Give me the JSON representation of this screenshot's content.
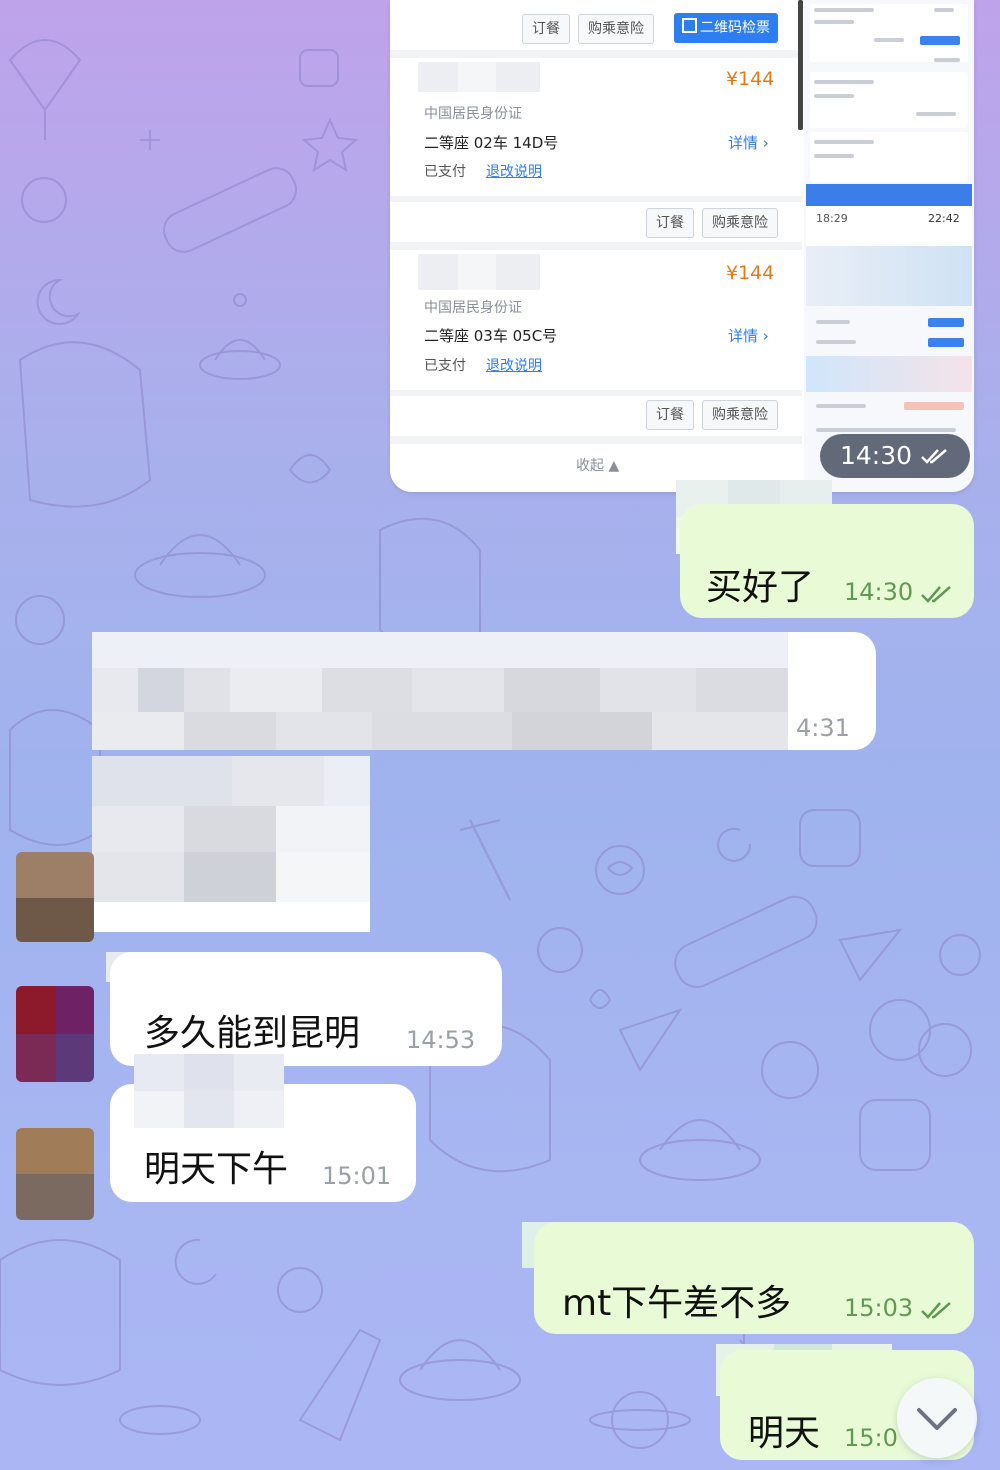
{
  "screenshot": {
    "top_buttons": {
      "meal": "订餐",
      "insurance": "购乘意险",
      "qr": "二维码检票"
    },
    "tickets": [
      {
        "price": "¥144",
        "id_type": "中国居民身份证",
        "seat": "二等座 02车 14D号",
        "status": "已支付",
        "refund_link": "退改说明",
        "detail": "详情 ›",
        "meal": "订餐",
        "insurance": "购乘意险"
      },
      {
        "price": "¥144",
        "id_type": "中国居民身份证",
        "seat": "二等座 03车 05C号",
        "status": "已支付",
        "refund_link": "退改说明",
        "detail": "详情 ›",
        "meal": "订餐",
        "insurance": "购乘意险"
      }
    ],
    "collapse_label": "收起 ▲",
    "app_preview": {
      "depart_time": "18:29",
      "arrive_time": "22:42"
    },
    "timestamp": "14:30"
  },
  "messages": [
    {
      "id": "bought",
      "direction": "outgoing",
      "text": "买好了",
      "time": "14:30"
    },
    {
      "id": "pixelated",
      "direction": "incoming",
      "text": "",
      "time": "4:31"
    },
    {
      "id": "how-long",
      "direction": "incoming",
      "text": "多久能到昆明",
      "time": "14:53"
    },
    {
      "id": "tomorrow-afternoon",
      "direction": "incoming",
      "text": "明天下午",
      "time": "15:01"
    },
    {
      "id": "mt-afternoon",
      "direction": "outgoing",
      "text": "mt下午差不多",
      "time": "15:03"
    },
    {
      "id": "tomorrow",
      "direction": "outgoing",
      "text": "明天",
      "time": "15:0"
    }
  ],
  "icons": [
    "double-check-icon",
    "chevron-down-icon",
    "qr-code-icon"
  ],
  "colors": {
    "outgoing_bubble": "#e9fbd6",
    "incoming_bubble": "#ffffff",
    "accent": "#2d7ef0",
    "price": "#e07b1a",
    "read_tick": "#5f9a52"
  }
}
